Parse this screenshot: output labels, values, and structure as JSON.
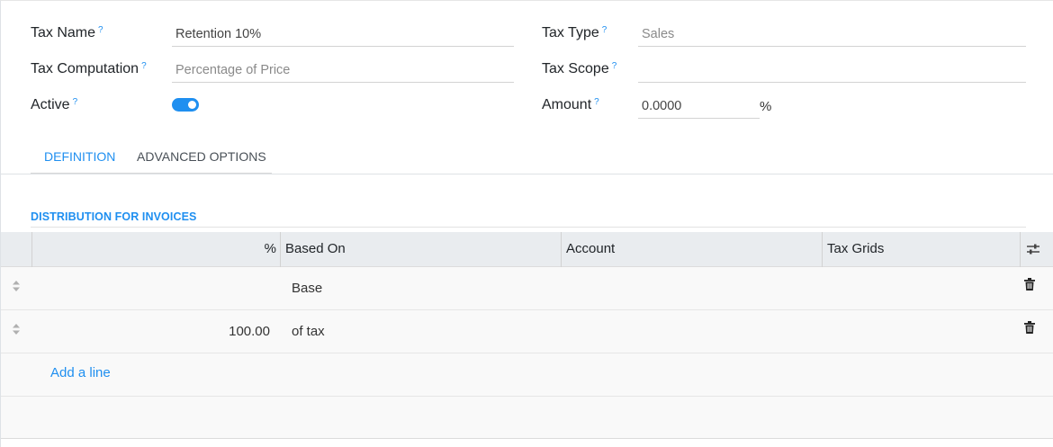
{
  "form": {
    "tax_name": {
      "label": "Tax Name",
      "help": "?",
      "value": "Retention 10%"
    },
    "tax_computation": {
      "label": "Tax Computation",
      "help": "?",
      "value": "Percentage of Price"
    },
    "active": {
      "label": "Active",
      "help": "?",
      "checked": true
    },
    "tax_type": {
      "label": "Tax Type",
      "help": "?",
      "value": "Sales"
    },
    "tax_scope": {
      "label": "Tax Scope",
      "help": "?",
      "value": ""
    },
    "amount": {
      "label": "Amount",
      "help": "?",
      "value": "0.0000",
      "suffix": "%"
    }
  },
  "tabs": [
    {
      "label": "Definition",
      "active": true
    },
    {
      "label": "Advanced Options",
      "active": false
    }
  ],
  "section": {
    "title": "DISTRIBUTION FOR INVOICES"
  },
  "table": {
    "columns": [
      "%",
      "Based On",
      "Account",
      "Tax Grids"
    ],
    "rows": [
      {
        "percent": "",
        "based_on": "Base",
        "account": "",
        "tax_grids": ""
      },
      {
        "percent": "100.00",
        "based_on": "of tax",
        "account": "",
        "tax_grids": ""
      }
    ],
    "add_line": "Add a line"
  },
  "colors": {
    "accent": "#1f8ff0",
    "header_bg": "#e9ecef",
    "row_bg": "#f9f9f9"
  },
  "icons": [
    "help-icon",
    "toggle-icon",
    "drag-handle-icon",
    "trash-icon",
    "optional-columns-icon"
  ]
}
